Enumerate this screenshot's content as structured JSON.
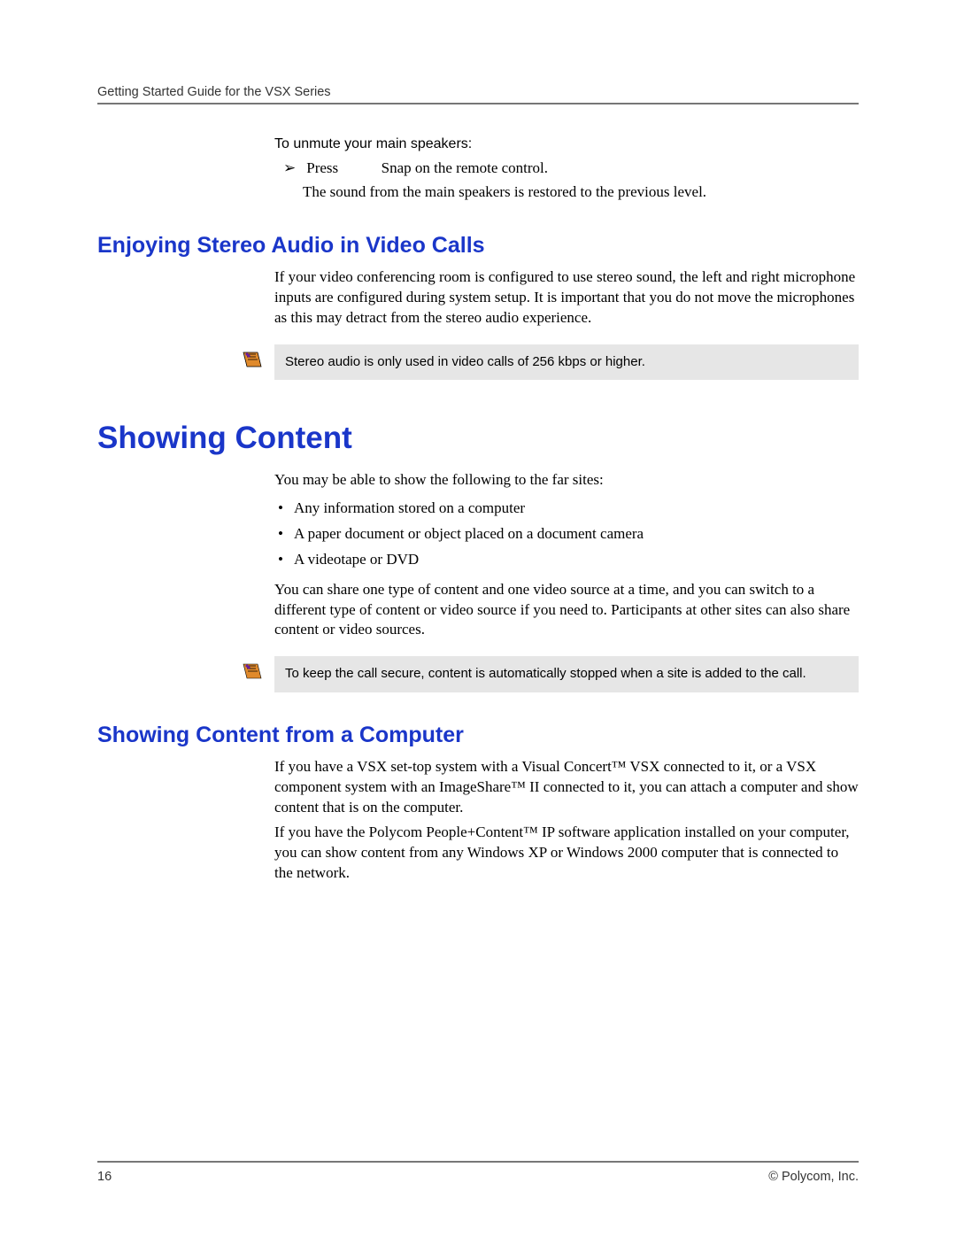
{
  "header": {
    "title": "Getting Started Guide for the VSX Series"
  },
  "section_unmute": {
    "lead": "To unmute your main speakers:",
    "step_prefix": "Press",
    "step_suffix": "Snap on the remote control.",
    "result": "The sound from the main speakers is restored to the previous level."
  },
  "section_stereo": {
    "heading": "Enjoying Stereo Audio in Video Calls",
    "body": "If your video conferencing room is configured to use stereo sound, the left and right microphone inputs are configured during system setup. It is important that you do not move the microphones as this may detract from the stereo audio experience.",
    "note": "Stereo audio is only used in video calls of 256 kbps or higher."
  },
  "section_showing": {
    "heading": "Showing Content",
    "intro": "You may be able to show the following to the far sites:",
    "bullets": [
      "Any information stored on a computer",
      "A paper document or object placed on a document camera",
      "A videotape or DVD"
    ],
    "body2": "You can share one type of content and one video source at a time, and you can switch to a different type of content or video source if you need to. Participants at other sites can also share content or video sources.",
    "note": "To keep the call secure, content is automatically stopped when a site is added to the call."
  },
  "section_computer": {
    "heading": "Showing Content from a Computer",
    "p1": "If you have a VSX set-top system with a Visual Concert™ VSX connected to it, or a VSX component system with an ImageShare™ II connected to it, you can attach a computer and show content that is on the computer.",
    "p2": "If you have the Polycom People+Content™ IP software application installed on your computer, you can show content from any Windows XP or Windows 2000 computer that is connected to the network."
  },
  "footer": {
    "page_number": "16",
    "copyright": "© Polycom, Inc."
  }
}
